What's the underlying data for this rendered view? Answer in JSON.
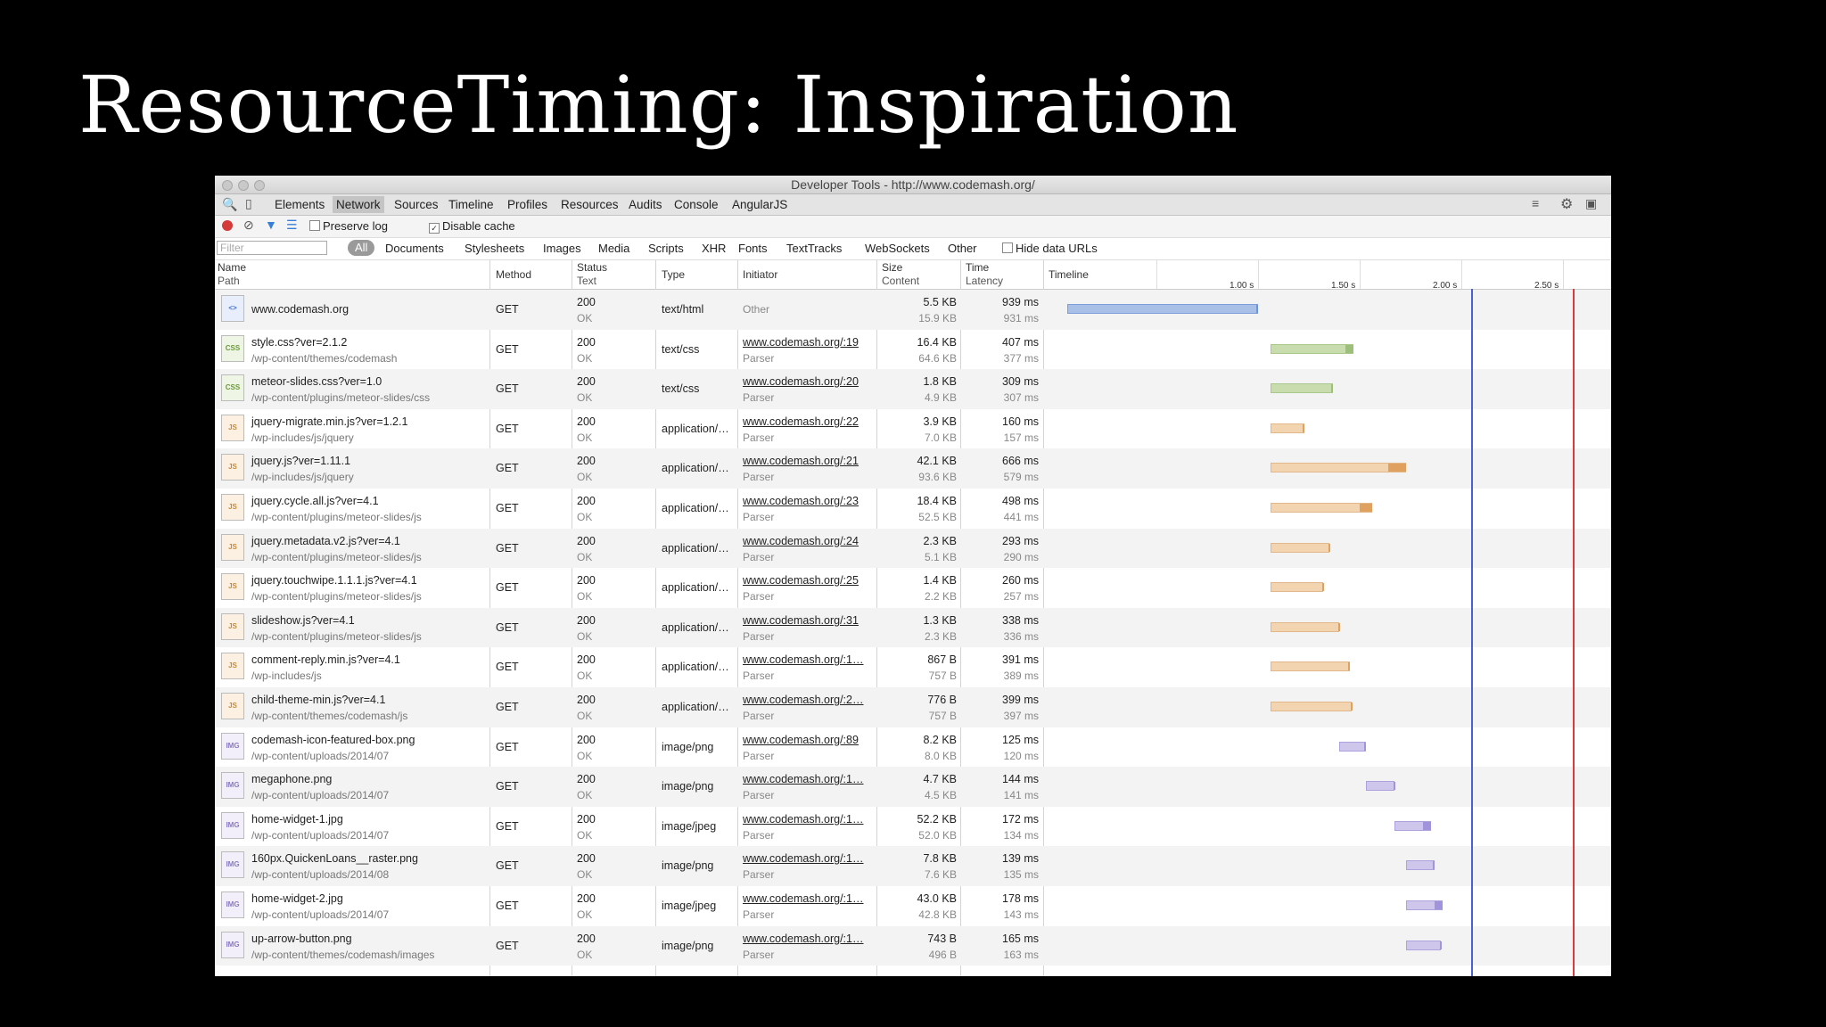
{
  "slide_title": "ResourceTiming: Inspiration",
  "window_title": "Developer Tools - http://www.codemash.org/",
  "tabs": [
    "Elements",
    "Network",
    "Sources",
    "Timeline",
    "Profiles",
    "Resources",
    "Audits",
    "Console",
    "AngularJS"
  ],
  "active_tab": "Network",
  "toolbar": {
    "preserve_log": "Preserve log",
    "disable_cache": "Disable cache",
    "preserve_log_checked": false,
    "disable_cache_checked": true
  },
  "filter": {
    "placeholder": "Filter",
    "types": [
      "All",
      "Documents",
      "Stylesheets",
      "Images",
      "Media",
      "Scripts",
      "XHR",
      "Fonts",
      "TextTracks",
      "WebSockets",
      "Other"
    ],
    "active_type": "All",
    "hide_data_urls": "Hide data URLs"
  },
  "columns": {
    "name": "Name",
    "path": "Path",
    "method": "Method",
    "status": "Status",
    "text": "Text",
    "type": "Type",
    "initiator": "Initiator",
    "size": "Size",
    "content": "Content",
    "time": "Time",
    "latency": "Latency",
    "timeline": "Timeline"
  },
  "timeline_ticks": [
    "1.00 s",
    "1.50 s",
    "2.00 s",
    "2.50 s"
  ],
  "colors": {
    "document": "#a8bfe8",
    "stylesheet": "#c9dcae",
    "script": "#f2d4b0",
    "image": "#cfc6ec",
    "dom_content_loaded": "#4a5fd6",
    "load": "#d83c3c"
  },
  "requests": [
    {
      "name": "www.codemash.org",
      "path": "",
      "method": "GET",
      "status": "200",
      "text": "OK",
      "type": "text/html",
      "initiator": "Other",
      "initiator_detail": "",
      "size": "5.5 KB",
      "content": "15.9 KB",
      "time": "939 ms",
      "latency": "931 ms",
      "kind": "document",
      "start_s": 0.06,
      "end_s": 1.0,
      "latency_s": 0.99
    },
    {
      "name": "style.css?ver=2.1.2",
      "path": "/wp-content/themes/codemash",
      "method": "GET",
      "status": "200",
      "text": "OK",
      "type": "text/css",
      "initiator": "www.codemash.org/:19",
      "initiator_detail": "Parser",
      "size": "16.4 KB",
      "content": "64.6 KB",
      "time": "407 ms",
      "latency": "377 ms",
      "kind": "stylesheet",
      "start_s": 1.06,
      "end_s": 1.47,
      "latency_s": 1.43
    },
    {
      "name": "meteor-slides.css?ver=1.0",
      "path": "/wp-content/plugins/meteor-slides/css",
      "method": "GET",
      "status": "200",
      "text": "OK",
      "type": "text/css",
      "initiator": "www.codemash.org/:20",
      "initiator_detail": "Parser",
      "size": "1.8 KB",
      "content": "4.9 KB",
      "time": "309 ms",
      "latency": "307 ms",
      "kind": "stylesheet",
      "start_s": 1.06,
      "end_s": 1.37,
      "latency_s": 1.36
    },
    {
      "name": "jquery-migrate.min.js?ver=1.2.1",
      "path": "/wp-includes/js/jquery",
      "method": "GET",
      "status": "200",
      "text": "OK",
      "type": "application/…",
      "initiator": "www.codemash.org/:22",
      "initiator_detail": "Parser",
      "size": "3.9 KB",
      "content": "7.0 KB",
      "time": "160 ms",
      "latency": "157 ms",
      "kind": "script",
      "start_s": 1.06,
      "end_s": 1.23,
      "latency_s": 1.22
    },
    {
      "name": "jquery.js?ver=1.11.1",
      "path": "/wp-includes/js/jquery",
      "method": "GET",
      "status": "200",
      "text": "OK",
      "type": "application/…",
      "initiator": "www.codemash.org/:21",
      "initiator_detail": "Parser",
      "size": "42.1 KB",
      "content": "93.6 KB",
      "time": "666 ms",
      "latency": "579 ms",
      "kind": "script",
      "start_s": 1.06,
      "end_s": 1.73,
      "latency_s": 1.64
    },
    {
      "name": "jquery.cycle.all.js?ver=4.1",
      "path": "/wp-content/plugins/meteor-slides/js",
      "method": "GET",
      "status": "200",
      "text": "OK",
      "type": "application/…",
      "initiator": "www.codemash.org/:23",
      "initiator_detail": "Parser",
      "size": "18.4 KB",
      "content": "52.5 KB",
      "time": "498 ms",
      "latency": "441 ms",
      "kind": "script",
      "start_s": 1.06,
      "end_s": 1.56,
      "latency_s": 1.5
    },
    {
      "name": "jquery.metadata.v2.js?ver=4.1",
      "path": "/wp-content/plugins/meteor-slides/js",
      "method": "GET",
      "status": "200",
      "text": "OK",
      "type": "application/…",
      "initiator": "www.codemash.org/:24",
      "initiator_detail": "Parser",
      "size": "2.3 KB",
      "content": "5.1 KB",
      "time": "293 ms",
      "latency": "290 ms",
      "kind": "script",
      "start_s": 1.06,
      "end_s": 1.35,
      "latency_s": 1.345
    },
    {
      "name": "jquery.touchwipe.1.1.1.js?ver=4.1",
      "path": "/wp-content/plugins/meteor-slides/js",
      "method": "GET",
      "status": "200",
      "text": "OK",
      "type": "application/…",
      "initiator": "www.codemash.org/:25",
      "initiator_detail": "Parser",
      "size": "1.4 KB",
      "content": "2.2 KB",
      "time": "260 ms",
      "latency": "257 ms",
      "kind": "script",
      "start_s": 1.06,
      "end_s": 1.32,
      "latency_s": 1.315
    },
    {
      "name": "slideshow.js?ver=4.1",
      "path": "/wp-content/plugins/meteor-slides/js",
      "method": "GET",
      "status": "200",
      "text": "OK",
      "type": "application/…",
      "initiator": "www.codemash.org/:31",
      "initiator_detail": "Parser",
      "size": "1.3 KB",
      "content": "2.3 KB",
      "time": "338 ms",
      "latency": "336 ms",
      "kind": "script",
      "start_s": 1.06,
      "end_s": 1.4,
      "latency_s": 1.395
    },
    {
      "name": "comment-reply.min.js?ver=4.1",
      "path": "/wp-includes/js",
      "method": "GET",
      "status": "200",
      "text": "OK",
      "type": "application/…",
      "initiator": "www.codemash.org/:1…",
      "initiator_detail": "Parser",
      "size": "867 B",
      "content": "757 B",
      "time": "391 ms",
      "latency": "389 ms",
      "kind": "script",
      "start_s": 1.06,
      "end_s": 1.45,
      "latency_s": 1.445
    },
    {
      "name": "child-theme-min.js?ver=4.1",
      "path": "/wp-content/themes/codemash/js",
      "method": "GET",
      "status": "200",
      "text": "OK",
      "type": "application/…",
      "initiator": "www.codemash.org/:2…",
      "initiator_detail": "Parser",
      "size": "776 B",
      "content": "757 B",
      "time": "399 ms",
      "latency": "397 ms",
      "kind": "script",
      "start_s": 1.06,
      "end_s": 1.46,
      "latency_s": 1.455
    },
    {
      "name": "codemash-icon-featured-box.png",
      "path": "/wp-content/uploads/2014/07",
      "method": "GET",
      "status": "200",
      "text": "OK",
      "type": "image/png",
      "initiator": "www.codemash.org/:89",
      "initiator_detail": "Parser",
      "size": "8.2 KB",
      "content": "8.0 KB",
      "time": "125 ms",
      "latency": "120 ms",
      "kind": "image",
      "start_s": 1.4,
      "end_s": 1.53,
      "latency_s": 1.52
    },
    {
      "name": "megaphone.png",
      "path": "/wp-content/uploads/2014/07",
      "method": "GET",
      "status": "200",
      "text": "OK",
      "type": "image/png",
      "initiator": "www.codemash.org/:1…",
      "initiator_detail": "Parser",
      "size": "4.7 KB",
      "content": "4.5 KB",
      "time": "144 ms",
      "latency": "141 ms",
      "kind": "image",
      "start_s": 1.53,
      "end_s": 1.67,
      "latency_s": 1.665
    },
    {
      "name": "home-widget-1.jpg",
      "path": "/wp-content/uploads/2014/07",
      "method": "GET",
      "status": "200",
      "text": "OK",
      "type": "image/jpeg",
      "initiator": "www.codemash.org/:1…",
      "initiator_detail": "Parser",
      "size": "52.2 KB",
      "content": "52.0 KB",
      "time": "172 ms",
      "latency": "134 ms",
      "kind": "image",
      "start_s": 1.67,
      "end_s": 1.85,
      "latency_s": 1.81
    },
    {
      "name": "160px.QuickenLoans__raster.png",
      "path": "/wp-content/uploads/2014/08",
      "method": "GET",
      "status": "200",
      "text": "OK",
      "type": "image/png",
      "initiator": "www.codemash.org/:1…",
      "initiator_detail": "Parser",
      "size": "7.8 KB",
      "content": "7.6 KB",
      "time": "139 ms",
      "latency": "135 ms",
      "kind": "image",
      "start_s": 1.73,
      "end_s": 1.87,
      "latency_s": 1.86
    },
    {
      "name": "home-widget-2.jpg",
      "path": "/wp-content/uploads/2014/07",
      "method": "GET",
      "status": "200",
      "text": "OK",
      "type": "image/jpeg",
      "initiator": "www.codemash.org/:1…",
      "initiator_detail": "Parser",
      "size": "43.0 KB",
      "content": "42.8 KB",
      "time": "178 ms",
      "latency": "143 ms",
      "kind": "image",
      "start_s": 1.73,
      "end_s": 1.91,
      "latency_s": 1.87
    },
    {
      "name": "up-arrow-button.png",
      "path": "/wp-content/themes/codemash/images",
      "method": "GET",
      "status": "200",
      "text": "OK",
      "type": "image/png",
      "initiator": "www.codemash.org/:1…",
      "initiator_detail": "Parser",
      "size": "743 B",
      "content": "496 B",
      "time": "165 ms",
      "latency": "163 ms",
      "kind": "image",
      "start_s": 1.73,
      "end_s": 1.9,
      "latency_s": 1.895
    }
  ],
  "timeline_markers": {
    "dom_content_loaded_s": 2.05,
    "load_s": 2.55
  }
}
